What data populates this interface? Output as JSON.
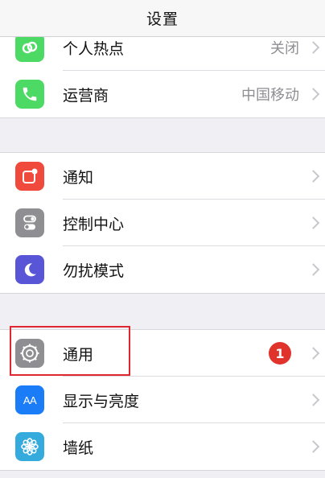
{
  "navbar": {
    "title": "设置"
  },
  "group1": {
    "items": [
      {
        "label": "个人热点",
        "value": "关闭",
        "icon": "link-icon",
        "color": "#4cd964"
      },
      {
        "label": "运营商",
        "value": "中国移动",
        "icon": "phone-icon",
        "color": "#4cd964"
      }
    ]
  },
  "group2": {
    "items": [
      {
        "label": "通知",
        "icon": "notification-icon",
        "color": "#f04a3c"
      },
      {
        "label": "控制中心",
        "icon": "toggle-icon",
        "color": "#8e8e93"
      },
      {
        "label": "勿扰模式",
        "icon": "moon-icon",
        "color": "#5856d6"
      }
    ]
  },
  "group3": {
    "items": [
      {
        "label": "通用",
        "badge": "1",
        "icon": "gear-icon",
        "color": "#8e8e93"
      },
      {
        "label": "显示与亮度",
        "icon": "aa-icon",
        "glyph": "AA",
        "color": "#1a7cf6"
      },
      {
        "label": "墙纸",
        "icon": "flower-icon",
        "color": "#35aadc"
      }
    ]
  },
  "annotation": {
    "highlight": "通用",
    "color": "#e0262e"
  }
}
